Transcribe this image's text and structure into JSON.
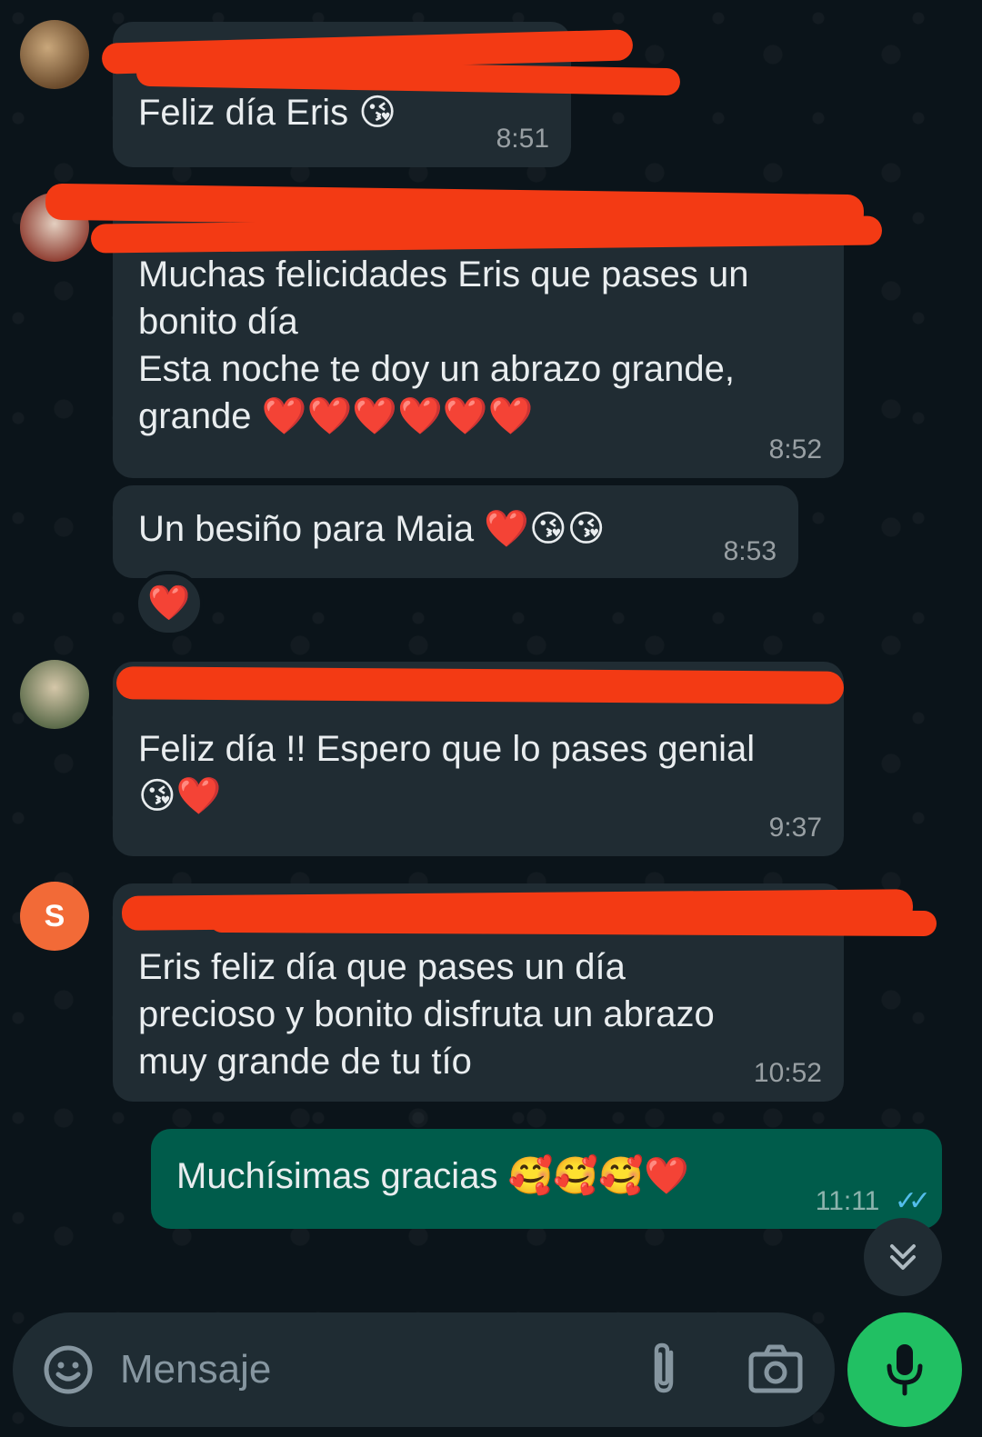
{
  "messages": [
    {
      "id": "m1",
      "text": "Feliz día Eris 😘",
      "time": "8:51"
    },
    {
      "id": "m2",
      "text": "Muchas felicidades Eris que pases un\nbonito día\nEsta noche te doy un abrazo grande,\ngrande ❤️❤️❤️❤️❤️❤️",
      "time": "8:52"
    },
    {
      "id": "m3",
      "text": "Un besiño para Maia ❤️😘😘",
      "time": "8:53",
      "reaction": "❤️"
    },
    {
      "id": "m4",
      "text": "Feliz día !! Espero que lo pases genial\n😘❤️",
      "time": "9:37"
    },
    {
      "id": "m5",
      "avatar_letter": "S",
      "text": "Eris feliz día que pases un día\nprecioso y bonito disfruta un abrazo\nmuy grande de tu tío",
      "time": "10:52"
    },
    {
      "id": "m6",
      "outgoing": true,
      "text": "Muchísimas gracias 🥰🥰🥰❤️",
      "time": "11:11",
      "status": "read"
    }
  ],
  "composer": {
    "placeholder": "Mensaje"
  },
  "colors": {
    "background": "#0b141a",
    "incoming_bubble": "#202c33",
    "outgoing_bubble": "#005c4b",
    "redaction": "#f33a14",
    "mic_button": "#21c063",
    "read_ticks": "#53bdeb"
  },
  "icons": [
    "emoji-icon",
    "attach-icon",
    "camera-icon",
    "mic-icon",
    "scroll-down-icon",
    "read-ticks-icon"
  ]
}
